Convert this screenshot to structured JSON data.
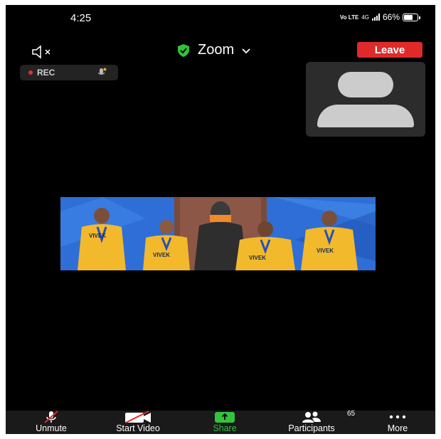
{
  "status_bar": {
    "time": "4:25",
    "network": "Vo LTE",
    "signal_type": "4G",
    "battery_percent": "66%"
  },
  "header": {
    "meeting_title": "Zoom",
    "leave_label": "Leave",
    "speaker_icon": "speaker-muted-icon",
    "secure_icon": "shield-check-icon",
    "accent_green": "#2fc33b",
    "leave_color": "#e02a2a"
  },
  "recording": {
    "label": "REC",
    "dot_color": "#e62e2e"
  },
  "shared_video": {
    "shirt_texts": [
      "VIVEK",
      "VIVEK",
      "VIVEK",
      "VIVEK"
    ]
  },
  "toolbar": {
    "items": [
      {
        "label": "Unmute",
        "icon": "mic-off-icon"
      },
      {
        "label": "Start Video",
        "icon": "video-off-icon"
      },
      {
        "label": "Share",
        "icon": "share-arrow-icon"
      },
      {
        "label": "Participants",
        "icon": "participants-icon",
        "count": "65"
      },
      {
        "label": "More",
        "icon": "more-dots-icon"
      }
    ]
  }
}
